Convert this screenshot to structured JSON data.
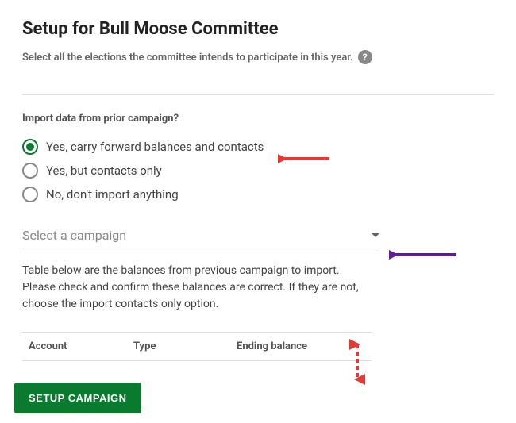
{
  "header": {
    "title": "Setup for Bull Moose Committee",
    "subtitle": "Select all the elections the committee intends to participate in this year."
  },
  "import_section": {
    "label": "Import data from prior campaign?",
    "options": [
      "Yes, carry forward balances and contacts",
      "Yes, but contacts only",
      "No, don't import anything"
    ],
    "selected_index": 0
  },
  "campaign_select": {
    "placeholder": "Select a campaign"
  },
  "table": {
    "description": "Table below are the balances from previous campaign to import. Please check and confirm these balances are correct. If they are not, choose the import contacts only option.",
    "columns": {
      "account": "Account",
      "type": "Type",
      "balance": "Ending balance"
    }
  },
  "actions": {
    "setup_button": "SETUP CAMPAIGN"
  }
}
